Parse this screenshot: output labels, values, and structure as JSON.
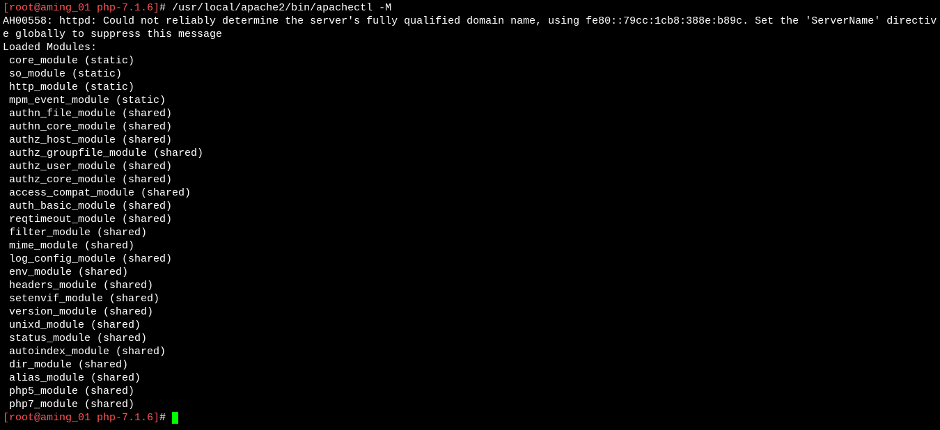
{
  "prompt1": {
    "bracketed": "[root@aming_01 php-7.1.6]",
    "hash": "# ",
    "command": "/usr/local/apache2/bin/apachectl -M"
  },
  "warning": "AH00558: httpd: Could not reliably determine the server's fully qualified domain name, using fe80::79cc:1cb8:388e:b89c. Set the 'ServerName' directive globally to suppress this message",
  "header": "Loaded Modules:",
  "modules": [
    " core_module (static)",
    " so_module (static)",
    " http_module (static)",
    " mpm_event_module (static)",
    " authn_file_module (shared)",
    " authn_core_module (shared)",
    " authz_host_module (shared)",
    " authz_groupfile_module (shared)",
    " authz_user_module (shared)",
    " authz_core_module (shared)",
    " access_compat_module (shared)",
    " auth_basic_module (shared)",
    " reqtimeout_module (shared)",
    " filter_module (shared)",
    " mime_module (shared)",
    " log_config_module (shared)",
    " env_module (shared)",
    " headers_module (shared)",
    " setenvif_module (shared)",
    " version_module (shared)",
    " unixd_module (shared)",
    " status_module (shared)",
    " autoindex_module (shared)",
    " dir_module (shared)",
    " alias_module (shared)",
    " php5_module (shared)",
    " php7_module (shared)"
  ],
  "prompt2": {
    "bracketed": "[root@aming_01 php-7.1.6]",
    "hash": "# "
  }
}
